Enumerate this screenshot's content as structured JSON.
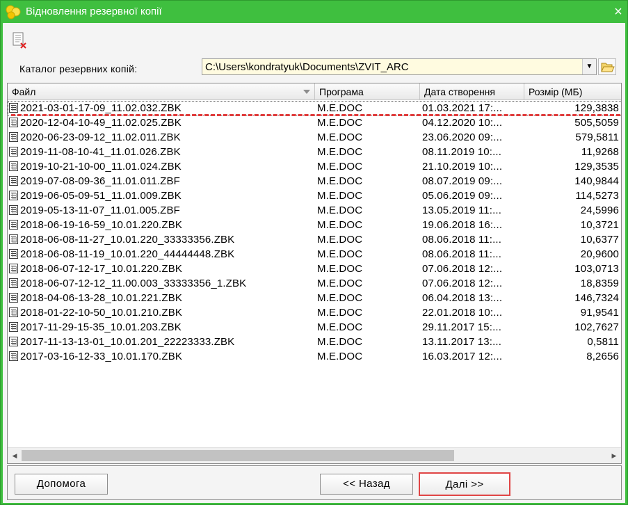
{
  "window": {
    "title": "Відновлення резервної копії",
    "close_label": "×"
  },
  "toolbar": {
    "delete_icon": "delete-file-icon"
  },
  "catalog": {
    "label": "Каталог резервних копій:",
    "value": "C:\\Users\\kondratyuk\\Documents\\ZVIT_ARC",
    "arrow": "▼"
  },
  "grid": {
    "columns": [
      "Файл",
      "Програма",
      "Дата створення",
      "Розмір (МБ)"
    ],
    "rows": [
      {
        "file": "2021-03-01-17-09_11.02.032.ZBK",
        "program": "M.E.DOC",
        "date": "01.03.2021 17:...",
        "size": "129,3838"
      },
      {
        "file": "2020-12-04-10-49_11.02.025.ZBK",
        "program": "M.E.DOC",
        "date": "04.12.2020 10:...",
        "size": "505,5059"
      },
      {
        "file": "2020-06-23-09-12_11.02.011.ZBK",
        "program": "M.E.DOC",
        "date": "23.06.2020 09:...",
        "size": "579,5811"
      },
      {
        "file": "2019-11-08-10-41_11.01.026.ZBK",
        "program": "M.E.DOC",
        "date": "08.11.2019 10:...",
        "size": "11,9268"
      },
      {
        "file": "2019-10-21-10-00_11.01.024.ZBK",
        "program": "M.E.DOC",
        "date": "21.10.2019 10:...",
        "size": "129,3535"
      },
      {
        "file": "2019-07-08-09-36_11.01.011.ZBF",
        "program": "M.E.DOC",
        "date": "08.07.2019 09:...",
        "size": "140,9844"
      },
      {
        "file": "2019-06-05-09-51_11.01.009.ZBK",
        "program": "M.E.DOC",
        "date": "05.06.2019 09:...",
        "size": "114,5273"
      },
      {
        "file": "2019-05-13-11-07_11.01.005.ZBF",
        "program": "M.E.DOC",
        "date": "13.05.2019 11:...",
        "size": "24,5996"
      },
      {
        "file": "2018-06-19-16-59_10.01.220.ZBK",
        "program": "M.E.DOC",
        "date": "19.06.2018 16:...",
        "size": "10,3721"
      },
      {
        "file": "2018-06-08-11-27_10.01.220_33333356.ZBK",
        "program": "M.E.DOC",
        "date": "08.06.2018 11:...",
        "size": "10,6377"
      },
      {
        "file": "2018-06-08-11-19_10.01.220_44444448.ZBK",
        "program": "M.E.DOC",
        "date": "08.06.2018 11:...",
        "size": "20,9600"
      },
      {
        "file": "2018-06-07-12-17_10.01.220.ZBK",
        "program": "M.E.DOC",
        "date": "07.06.2018 12:...",
        "size": "103,0713"
      },
      {
        "file": "2018-06-07-12-12_11.00.003_33333356_1.ZBK",
        "program": "M.E.DOC",
        "date": "07.06.2018 12:...",
        "size": "18,8359"
      },
      {
        "file": "2018-04-06-13-28_10.01.221.ZBK",
        "program": "M.E.DOC",
        "date": "06.04.2018 13:...",
        "size": "146,7324"
      },
      {
        "file": "2018-01-22-10-50_10.01.210.ZBK",
        "program": "M.E.DOC",
        "date": "22.01.2018 10:...",
        "size": "91,9541"
      },
      {
        "file": "2017-11-29-15-35_10.01.203.ZBK",
        "program": "M.E.DOC",
        "date": "29.11.2017 15:...",
        "size": "102,7627"
      },
      {
        "file": "2017-11-13-13-01_10.01.201_22223333.ZBK",
        "program": "M.E.DOC",
        "date": "13.11.2017 13:...",
        "size": "0,5811"
      },
      {
        "file": "2017-03-16-12-33_10.01.170.ZBK",
        "program": "M.E.DOC",
        "date": "16.03.2017 12:...",
        "size": "8,2656"
      }
    ],
    "scroll_left": "◀",
    "scroll_right": "▶"
  },
  "buttons": {
    "help": "Допомога",
    "back": "<< Назад",
    "next": "Далі >>"
  },
  "colors": {
    "title_bar": "#3fbf3f",
    "highlight": "#e04545",
    "combo_bg": "#fffbe0"
  }
}
